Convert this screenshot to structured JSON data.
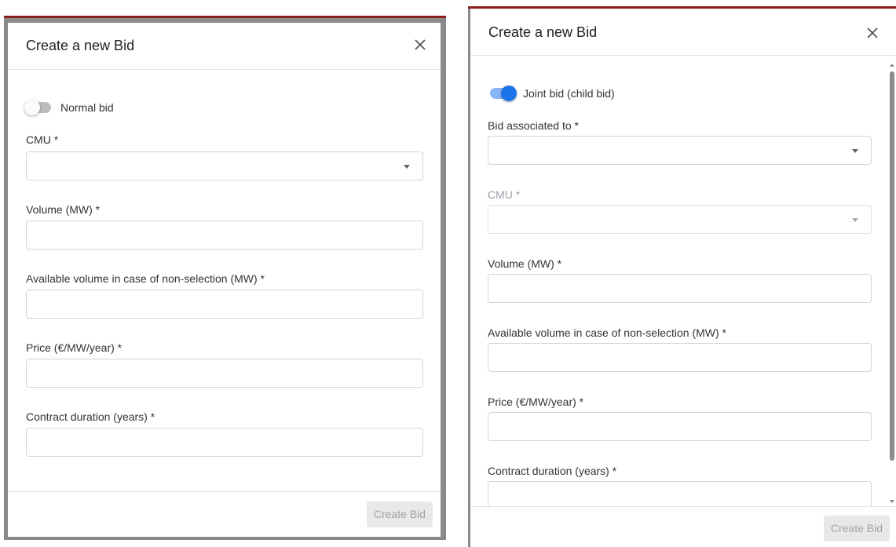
{
  "left_dialog": {
    "title": "Create a new Bid",
    "toggle_label": "Normal bid",
    "toggle_on": false,
    "fields": [
      {
        "label": "CMU *",
        "type": "select",
        "value": ""
      },
      {
        "label": "Volume (MW) *",
        "type": "text",
        "value": ""
      },
      {
        "label": "Available volume in case of non-selection (MW) *",
        "type": "text",
        "value": ""
      },
      {
        "label": "Price (€/MW/year) *",
        "type": "text",
        "value": ""
      },
      {
        "label": "Contract duration (years) *",
        "type": "text",
        "value": ""
      }
    ],
    "submit_label": "Create Bid"
  },
  "right_dialog": {
    "title": "Create a new Bid",
    "toggle_label": "Joint bid (child bid)",
    "toggle_on": true,
    "fields": [
      {
        "label": "Bid associated to *",
        "type": "select",
        "value": ""
      },
      {
        "label": "CMU *",
        "type": "select",
        "value": "",
        "disabled": true
      },
      {
        "label": "Volume (MW) *",
        "type": "text",
        "value": ""
      },
      {
        "label": "Available volume in case of non-selection (MW) *",
        "type": "text",
        "value": ""
      },
      {
        "label": "Price (€/MW/year) *",
        "type": "text",
        "value": ""
      },
      {
        "label": "Contract duration (years) *",
        "type": "text",
        "value": ""
      }
    ],
    "submit_label": "Create Bid"
  },
  "colors": {
    "accent": "#1a73e8",
    "header_bar": "#8b1e1e",
    "disabled_button_bg": "#e8e8e8",
    "disabled_button_text": "#a3a3a3"
  }
}
